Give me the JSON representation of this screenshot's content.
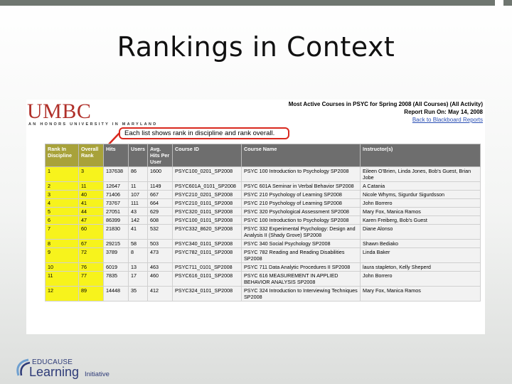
{
  "slide": {
    "title": "Rankings in Context"
  },
  "report": {
    "logo": "UMBC",
    "tagline": "AN HONORS UNIVERSITY IN MARYLAND",
    "header_line1": "Most Active Courses in PSYC for Spring 2008 (All Courses) (All Activity)",
    "header_line2": "Report Run On: May 14, 2008",
    "back_link": "Back to Blackboard Reports",
    "callout": "Each list shows rank in discipline and rank overall.",
    "columns": [
      "Rank In Discipline",
      "Overall Rank",
      "Hits",
      "Users",
      "Avg. Hits Per User",
      "Course ID",
      "Course Name",
      "Instructor(s)"
    ],
    "rows": [
      [
        "1",
        "3",
        "137638",
        "86",
        "1600",
        "PSYC100_0201_SP2008",
        "PSYC 100 Introduction to Psychology SP2008",
        "Eileen O'Brien, Linda Jones, Bob's Guest, Brian Jobe"
      ],
      [
        "2",
        "11",
        "12647",
        "11",
        "1149",
        "PSYC601A_0101_SP2008",
        "PSYC 601A Seminar in Verbal Behavior SP2008",
        "A Catania"
      ],
      [
        "3",
        "40",
        "71406",
        "107",
        "667",
        "PSYC210_0201_SP2008",
        "PSYC 210 Psychology of Learning SP2008",
        "Nicole Whyms, Sigurdur Sigurdsson"
      ],
      [
        "4",
        "41",
        "73767",
        "111",
        "664",
        "PSYC210_0101_SP2008",
        "PSYC 210 Psychology of Learning SP2008",
        "John Borrero"
      ],
      [
        "5",
        "44",
        "27051",
        "43",
        "629",
        "PSYC320_0101_SP2008",
        "PSYC 320 Psychological Assessment SP2008",
        "Mary Fox, Manica Ramos"
      ],
      [
        "6",
        "47",
        "86399",
        "142",
        "608",
        "PSYC100_0101_SP2008",
        "PSYC 100 Introduction to Psychology SP2008",
        "Karen Freiberg, Bob's Guest"
      ],
      [
        "7",
        "60",
        "21830",
        "41",
        "532",
        "PSYC332_8620_SP2008",
        "PSYC 332 Experimental Psychology: Design and Analysis II (Shady Grove) SP2008",
        "Diane Alonso"
      ],
      [
        "8",
        "67",
        "29215",
        "58",
        "503",
        "PSYC340_0101_SP2008",
        "PSYC 340 Social Psychology SP2008",
        "Shawn Bediako"
      ],
      [
        "9",
        "72",
        "3789",
        "8",
        "473",
        "PSYC782_0101_SP2008",
        "PSYC 782 Reading and Reading Disabilities SP2008",
        "Linda Baker"
      ],
      [
        "10",
        "76",
        "6019",
        "13",
        "463",
        "PSYC711_0101_SP2008",
        "PSYC 711 Data Analytic Procedures II SP2008",
        "laura stapleton, Kelly Sheperd"
      ],
      [
        "11",
        "77",
        "7835",
        "17",
        "460",
        "PSYC616_0101_SP2008",
        "PSYC 616 MEASUREMENT IN APPLIED BEHAVIOR ANALYSIS SP2008",
        "John Borrero"
      ],
      [
        "12",
        "89",
        "14448",
        "35",
        "412",
        "PSYC324_0101_SP2008",
        "PSYC 324 Introduction to Interviewing Techniques SP2008",
        "Mary Fox, Manica Ramos"
      ]
    ]
  },
  "footer_logo": {
    "top": "EDUCAUSE",
    "big": "Learning",
    "small": "Initiative"
  },
  "colors": {
    "highlight": "#f7f31c",
    "umbc_red": "#b0302a",
    "callout_border": "#d9281e",
    "header_gray": "#6e6e6e"
  }
}
